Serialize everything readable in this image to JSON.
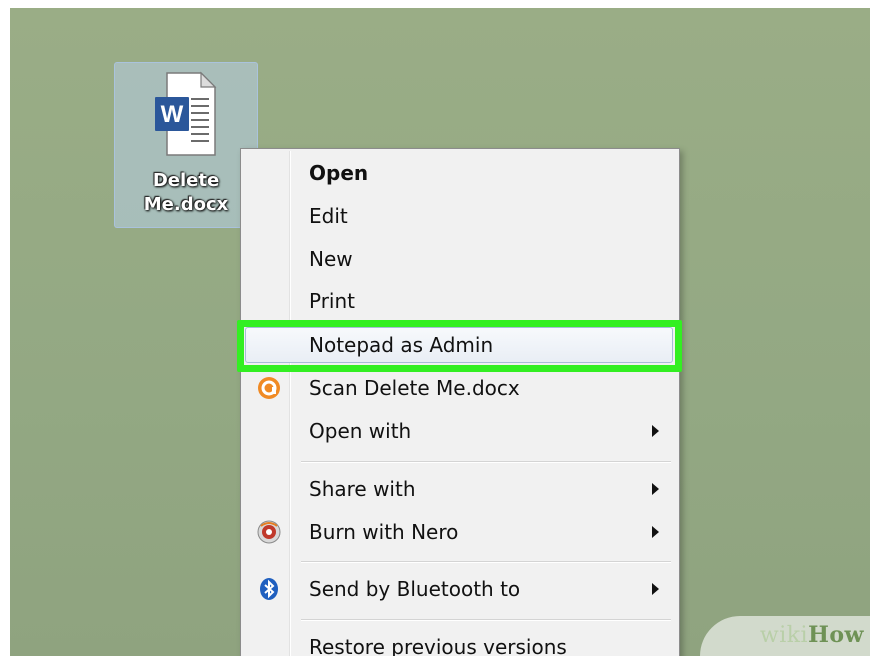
{
  "desktop": {
    "file": {
      "name_line1": "Delete",
      "name_line2": "Me.docx",
      "app_letter": "W"
    }
  },
  "context_menu": {
    "items": [
      {
        "label": "Open",
        "bold": true,
        "submenu": false,
        "icon": ""
      },
      {
        "label": "Edit",
        "bold": false,
        "submenu": false,
        "icon": ""
      },
      {
        "label": "New",
        "bold": false,
        "submenu": false,
        "icon": ""
      },
      {
        "label": "Print",
        "bold": false,
        "submenu": false,
        "icon": ""
      },
      {
        "label": "Notepad as Admin",
        "bold": false,
        "submenu": false,
        "icon": "",
        "highlighted": true
      },
      {
        "label": "Scan Delete Me.docx",
        "bold": false,
        "submenu": false,
        "icon": "avast-icon"
      },
      {
        "label": "Open with",
        "bold": false,
        "submenu": true,
        "icon": ""
      },
      {
        "label": "Share with",
        "bold": false,
        "submenu": true,
        "icon": ""
      },
      {
        "label": "Burn with Nero",
        "bold": false,
        "submenu": true,
        "icon": "nero-icon"
      },
      {
        "label": "Send by Bluetooth to",
        "bold": false,
        "submenu": true,
        "icon": "bluetooth-icon"
      },
      {
        "label": "Restore previous versions",
        "bold": false,
        "submenu": false,
        "icon": ""
      }
    ]
  },
  "watermark": {
    "part1": "wiki",
    "part2": "How"
  },
  "colors": {
    "highlight_border": "#33ef22",
    "desktop_bg": "#93a883",
    "word_blue": "#2b579a"
  }
}
